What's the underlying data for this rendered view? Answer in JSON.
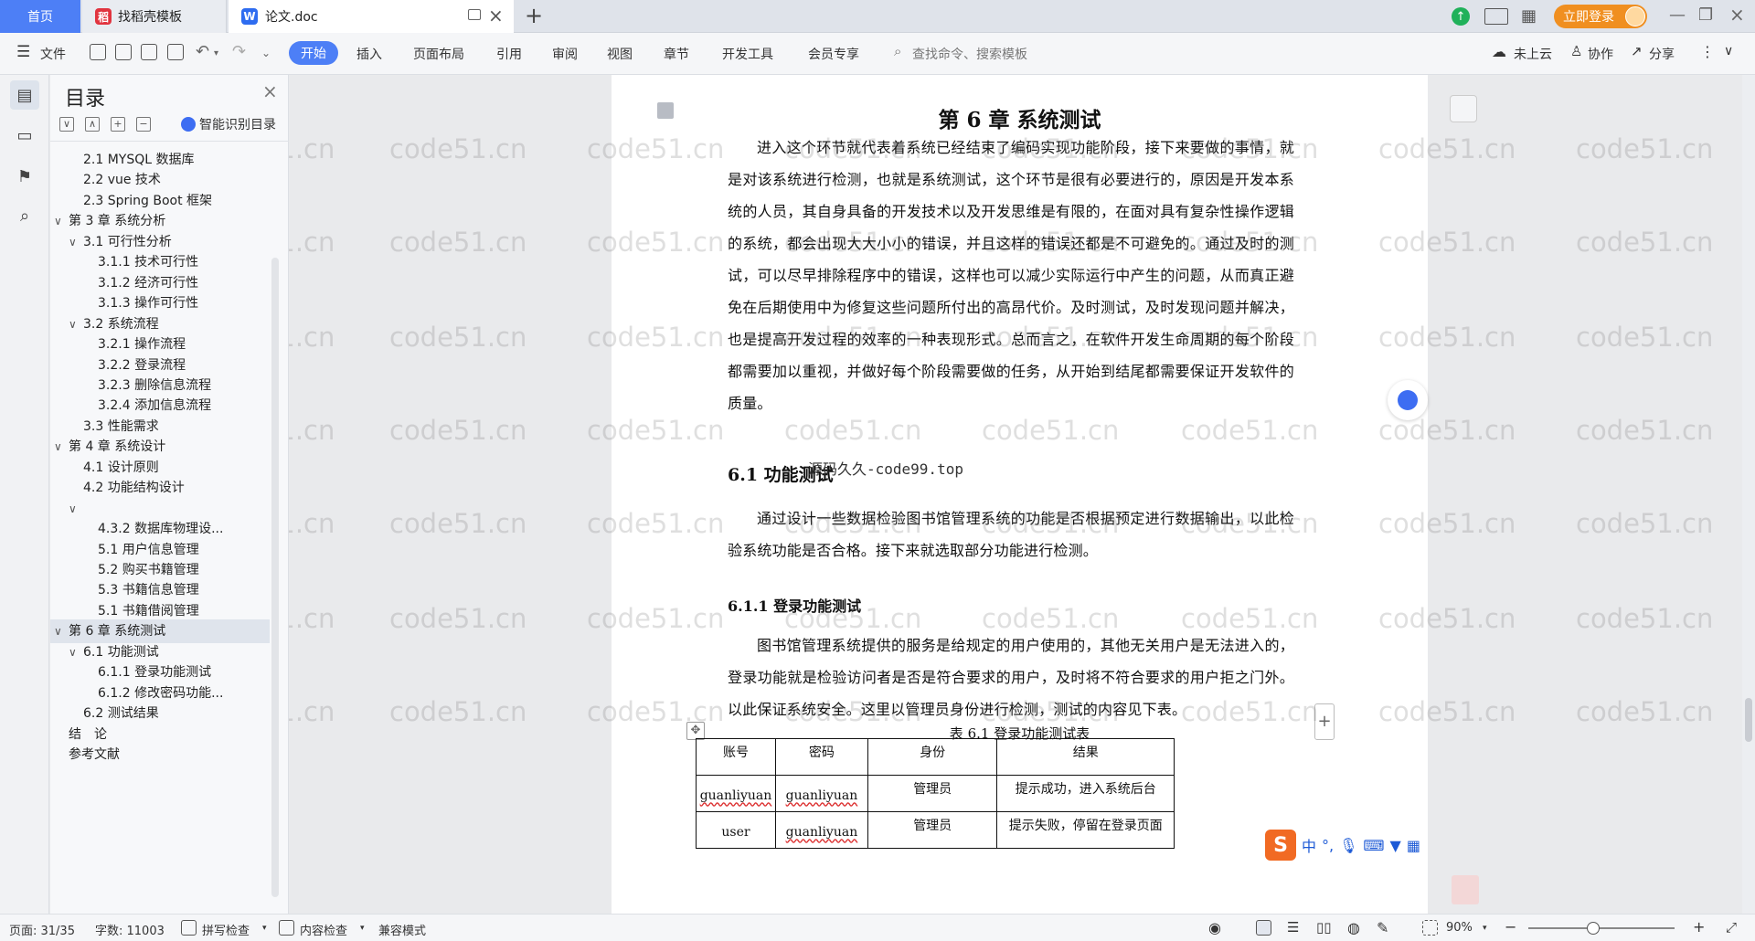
{
  "tabs": {
    "home": "首页",
    "daoke": "找稻壳模板",
    "doc": "论文.doc",
    "add": "+"
  },
  "titlebar": {
    "login": "立即登录"
  },
  "ribbon": {
    "file": "文件",
    "start": "开始",
    "menus": [
      "插入",
      "页面布局",
      "引用",
      "审阅",
      "视图",
      "章节",
      "开发工具",
      "会员专享"
    ],
    "search": "查找命令、搜索模板",
    "cloud": "未上云",
    "collab": "协作",
    "share": "分享"
  },
  "toc": {
    "title": "目录",
    "ai": "智能识别目录",
    "items": [
      {
        "label": "2.1 MYSQL 数据库",
        "level": 2
      },
      {
        "label": "2.2 vue 技术",
        "level": 2
      },
      {
        "label": "2.3 Spring Boot 框架",
        "level": 2
      },
      {
        "label": "第 3 章 系统分析",
        "level": 1,
        "toggle": "∨"
      },
      {
        "label": "3.1 可行性分析",
        "level": 2,
        "toggle": "∨"
      },
      {
        "label": "3.1.1 技术可行性",
        "level": 3
      },
      {
        "label": "3.1.2 经济可行性",
        "level": 3
      },
      {
        "label": "3.1.3 操作可行性",
        "level": 3
      },
      {
        "label": "3.2 系统流程",
        "level": 2,
        "toggle": "∨"
      },
      {
        "label": "3.2.1 操作流程",
        "level": 3
      },
      {
        "label": "3.2.2 登录流程",
        "level": 3
      },
      {
        "label": "3.2.3 删除信息流程",
        "level": 3
      },
      {
        "label": "3.2.4 添加信息流程",
        "level": 3
      },
      {
        "label": "3.3 性能需求",
        "level": 2
      },
      {
        "label": "第 4 章 系统设计",
        "level": 1,
        "toggle": "∨"
      },
      {
        "label": "4.1 设计原则",
        "level": 2
      },
      {
        "label": "4.2 功能结构设计",
        "level": 2
      },
      {
        "label": "",
        "level": 2,
        "toggle": "∨"
      },
      {
        "label": "4.3.2 数据库物理设...",
        "level": 3
      },
      {
        "label": "5.1 用户信息管理",
        "level": 3
      },
      {
        "label": "5.2 购买书籍管理",
        "level": 3
      },
      {
        "label": "5.3 书籍信息管理",
        "level": 3
      },
      {
        "label": "5.1 书籍借阅管理",
        "level": 3
      },
      {
        "label": "第 6 章 系统测试",
        "level": 1,
        "toggle": "∨",
        "active": true
      },
      {
        "label": "6.1 功能测试",
        "level": 2,
        "toggle": "∨"
      },
      {
        "label": "6.1.1 登录功能测试",
        "level": 3
      },
      {
        "label": "6.1.2 修改密码功能...",
        "level": 3
      },
      {
        "label": "6.2 测试结果",
        "level": 2
      },
      {
        "label": "结　论",
        "level": 1
      },
      {
        "label": "参考文献",
        "level": 1
      }
    ]
  },
  "document": {
    "chapter_title": "第 6 章  系统测试",
    "intro": "进入这个环节就代表着系统已经结束了编码实现功能阶段，接下来要做的事情，就是对该系统进行检测，也就是系统测试，这个环节是很有必要进行的，原因是开发本系统的人员，其自身具备的开发技术以及开发思维是有限的，在面对具有复杂性操作逻辑的系统，都会出现大大小小的错误，并且这样的错误还都是不可避免的。通过及时的测试，可以尽早排除程序中的错误，这样也可以减少实际运行中产生的问题，从而真正避免在后期使用中为修复这些问题所付出的高昂代价。及时测试，及时发现问题并解决，也是提高开发过程的效率的一种表现形式。总而言之，在软件开发生命周期的每个阶段都需要加以重视，并做好每个阶段需要做的任务，从开始到结尾都需要保证开发软件的质量。",
    "h2": "6.1  功能测试",
    "overlay_text": "源码久久-code99.top",
    "p2": "通过设计一些数据检验图书馆管理系统的功能是否根据预定进行数据输出，以此检验系统功能是否合格。接下来就选取部分功能进行检测。",
    "h3": "6.1.1  登录功能测试",
    "p3": "图书馆管理系统提供的服务是给规定的用户使用的，其他无关用户是无法进入的，登录功能就是检验访问者是否是符合要求的用户，及时将不符合要求的用户拒之门外。以此保证系统安全。这里以管理员身份进行检测，测试的内容见下表。",
    "table_caption": "表 6.1  登录功能测试表",
    "table": {
      "headers": [
        "账号",
        "密码",
        "身份",
        "结果"
      ],
      "rows": [
        [
          "guanliyuan",
          "guanliyuan",
          "管理员",
          "提示成功，进入系统后台"
        ],
        [
          "user",
          "guanliyuan",
          "管理员",
          "提示失败，停留在登录页面"
        ]
      ]
    }
  },
  "watermark": "code51.cn",
  "ime": {
    "mode": "中"
  },
  "status": {
    "page": "页面: 31/35",
    "words": "字数: 11003",
    "spell": "拼写检查",
    "content": "内容检查",
    "compat": "兼容模式",
    "zoom": "90%"
  }
}
